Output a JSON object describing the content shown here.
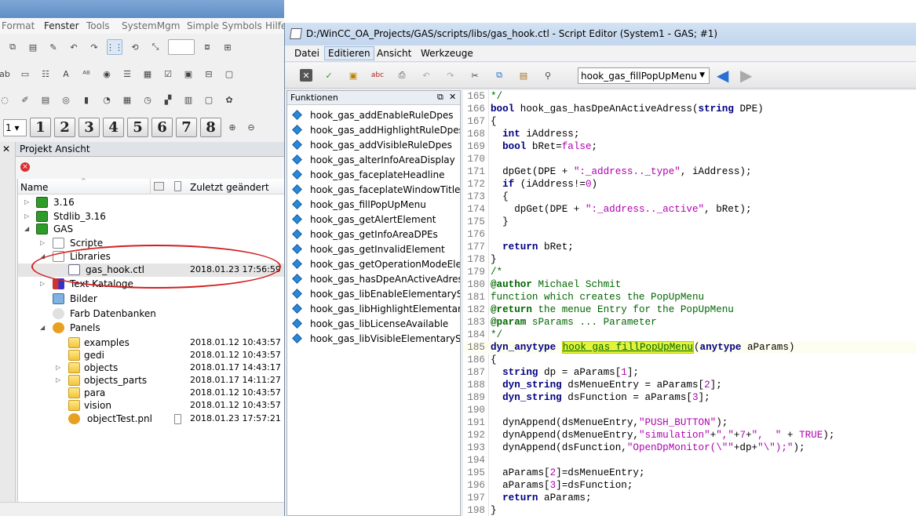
{
  "back_window": {
    "menu": [
      "Format",
      "Fenster",
      "Tools",
      "SystemMgm",
      "Simple Symbols",
      "Hilfe"
    ],
    "zoom_select": "1",
    "layer_buttons": [
      "2",
      "3",
      "4",
      "5",
      "6",
      "7",
      "8"
    ],
    "project_panel_title": "Projekt Ansicht",
    "tree_columns": {
      "name": "Name",
      "modified": "Zuletzt geändert"
    },
    "tree": [
      {
        "label": "3.16",
        "date": ""
      },
      {
        "label": "Stdlib_3.16",
        "date": ""
      },
      {
        "label": "GAS",
        "date": ""
      },
      {
        "label": "Scripte",
        "date": ""
      },
      {
        "label": "Libraries",
        "date": ""
      },
      {
        "label": "gas_hook.ctl",
        "date": "2018.01.23 17:56:59"
      },
      {
        "label": "Text Kataloge",
        "date": ""
      },
      {
        "label": "Bilder",
        "date": ""
      },
      {
        "label": "Farb Datenbanken",
        "date": ""
      },
      {
        "label": "Panels",
        "date": ""
      },
      {
        "label": "examples",
        "date": "2018.01.12 10:43:57"
      },
      {
        "label": "gedi",
        "date": "2018.01.12 10:43:57"
      },
      {
        "label": "objects",
        "date": "2018.01.17 14:43:17"
      },
      {
        "label": "objects_parts",
        "date": "2018.01.17 14:11:27"
      },
      {
        "label": "para",
        "date": "2018.01.12 10:43:57"
      },
      {
        "label": "vision",
        "date": "2018.01.12 10:43:57"
      },
      {
        "label": "objectTest.pnl",
        "date": "2018.01.23 17:57:21"
      }
    ]
  },
  "editor": {
    "title": "D:/WinCC_OA_Projects/GAS/scripts/libs/gas_hook.ctl - Script Editor (System1 - GAS; #1)",
    "menu": [
      "Datei",
      "Editieren",
      "Ansicht",
      "Werkzeuge"
    ],
    "function_select": "hook_gas_fillPopUpMenu",
    "functions_panel_title": "Funktionen",
    "functions": [
      "hook_gas_addEnableRuleDpes",
      "hook_gas_addHighlightRuleDpes",
      "hook_gas_addVisibleRuleDpes",
      "hook_gas_alterInfoAreaDisplay",
      "hook_gas_faceplateHeadline",
      "hook_gas_faceplateWindowTitle",
      "hook_gas_fillPopUpMenu",
      "hook_gas_getAlertElement",
      "hook_gas_getInfoAreaDPEs",
      "hook_gas_getInvalidElement",
      "hook_gas_getOperationModeElement",
      "hook_gas_hasDpeAnActiveAdress",
      "hook_gas_libEnableElementarySymbol",
      "hook_gas_libHighlightElementarySymbol",
      "hook_gas_libLicenseAvailable",
      "hook_gas_libVisibleElementarySymbol"
    ],
    "code": [
      {
        "n": "165",
        "segs": [
          [
            "c",
            "*/"
          ]
        ]
      },
      {
        "n": "166",
        "segs": [
          [
            "k",
            "bool"
          ],
          [
            "p",
            " hook_gas_hasDpeAnActiveAdress("
          ],
          [
            "k",
            "string"
          ],
          [
            "p",
            " DPE)"
          ]
        ]
      },
      {
        "n": "167",
        "segs": [
          [
            "p",
            "{"
          ]
        ]
      },
      {
        "n": "168",
        "segs": [
          [
            "p",
            "  "
          ],
          [
            "k",
            "int"
          ],
          [
            "p",
            " iAddress;"
          ]
        ]
      },
      {
        "n": "169",
        "segs": [
          [
            "p",
            "  "
          ],
          [
            "k",
            "bool"
          ],
          [
            "p",
            " bRet="
          ],
          [
            "s",
            "false"
          ],
          [
            "p",
            ";"
          ]
        ]
      },
      {
        "n": "170",
        "segs": [
          [
            "p",
            ""
          ]
        ]
      },
      {
        "n": "171",
        "segs": [
          [
            "p",
            "  dpGet(DPE + "
          ],
          [
            "s",
            "\":_address.._type\""
          ],
          [
            "p",
            ", iAddress);"
          ]
        ]
      },
      {
        "n": "172",
        "segs": [
          [
            "p",
            "  "
          ],
          [
            "k",
            "if"
          ],
          [
            "p",
            " (iAddress!="
          ],
          [
            "s",
            "0"
          ],
          [
            "p",
            ")"
          ]
        ]
      },
      {
        "n": "173",
        "segs": [
          [
            "p",
            "  {"
          ]
        ]
      },
      {
        "n": "174",
        "segs": [
          [
            "p",
            "    dpGet(DPE + "
          ],
          [
            "s",
            "\":_address.._active\""
          ],
          [
            "p",
            ", bRet);"
          ]
        ]
      },
      {
        "n": "175",
        "segs": [
          [
            "p",
            "  }"
          ]
        ]
      },
      {
        "n": "176",
        "segs": [
          [
            "p",
            ""
          ]
        ]
      },
      {
        "n": "177",
        "segs": [
          [
            "p",
            "  "
          ],
          [
            "k",
            "return"
          ],
          [
            "p",
            " bRet;"
          ]
        ]
      },
      {
        "n": "178",
        "segs": [
          [
            "p",
            "}"
          ]
        ]
      },
      {
        "n": "179",
        "segs": [
          [
            "c",
            "/*"
          ]
        ]
      },
      {
        "n": "180",
        "segs": [
          [
            "a",
            "@author"
          ],
          [
            "c",
            " Michael Schmit"
          ]
        ]
      },
      {
        "n": "181",
        "segs": [
          [
            "c",
            "function which creates the PopUpMenu"
          ]
        ]
      },
      {
        "n": "182",
        "segs": [
          [
            "a",
            "@return"
          ],
          [
            "c",
            " the menue Entry for the PopUpMenu"
          ]
        ]
      },
      {
        "n": "183",
        "segs": [
          [
            "a",
            "@param"
          ],
          [
            "c",
            " sParams ... Parameter"
          ]
        ]
      },
      {
        "n": "184",
        "segs": [
          [
            "c",
            "*/"
          ]
        ]
      },
      {
        "n": "185",
        "segs": [
          [
            "k",
            "dyn_anytype"
          ],
          [
            "p",
            " "
          ],
          [
            "h",
            "hook_gas_fillPopUpMenu"
          ],
          [
            "p",
            "("
          ],
          [
            "k",
            "anytype"
          ],
          [
            "p",
            " aParams)"
          ]
        ]
      },
      {
        "n": "186",
        "segs": [
          [
            "p",
            "{"
          ]
        ]
      },
      {
        "n": "187",
        "segs": [
          [
            "p",
            "  "
          ],
          [
            "k",
            "string"
          ],
          [
            "p",
            " dp = aParams["
          ],
          [
            "s",
            "1"
          ],
          [
            "p",
            "];"
          ]
        ]
      },
      {
        "n": "188",
        "segs": [
          [
            "p",
            "  "
          ],
          [
            "k",
            "dyn_string"
          ],
          [
            "p",
            " dsMenueEntry = aParams["
          ],
          [
            "s",
            "2"
          ],
          [
            "p",
            "];"
          ]
        ]
      },
      {
        "n": "189",
        "segs": [
          [
            "p",
            "  "
          ],
          [
            "k",
            "dyn_string"
          ],
          [
            "p",
            " dsFunction = aParams["
          ],
          [
            "s",
            "3"
          ],
          [
            "p",
            "];"
          ]
        ]
      },
      {
        "n": "190",
        "segs": [
          [
            "p",
            ""
          ]
        ]
      },
      {
        "n": "191",
        "segs": [
          [
            "p",
            "  dynAppend(dsMenueEntry,"
          ],
          [
            "s",
            "\"PUSH_BUTTON\""
          ],
          [
            "p",
            ");"
          ]
        ]
      },
      {
        "n": "192",
        "segs": [
          [
            "p",
            "  dynAppend(dsMenueEntry,"
          ],
          [
            "s",
            "\"simulation\""
          ],
          [
            "p",
            "+"
          ],
          [
            "s",
            "\",\""
          ],
          [
            "p",
            "+"
          ],
          [
            "s",
            "7"
          ],
          [
            "p",
            "+"
          ],
          [
            "s",
            "\",  \""
          ],
          [
            "p",
            " + "
          ],
          [
            "s",
            "TRUE"
          ],
          [
            "p",
            ");"
          ]
        ]
      },
      {
        "n": "193",
        "segs": [
          [
            "p",
            "  dynAppend(dsFunction,"
          ],
          [
            "s",
            "\"OpenDpMonitor(\\\"\""
          ],
          [
            "p",
            "+dp+"
          ],
          [
            "s",
            "\"\\\");\""
          ],
          [
            "p",
            ");"
          ]
        ]
      },
      {
        "n": "194",
        "segs": [
          [
            "p",
            ""
          ]
        ]
      },
      {
        "n": "195",
        "segs": [
          [
            "p",
            "  aParams["
          ],
          [
            "s",
            "2"
          ],
          [
            "p",
            "]=dsMenueEntry;"
          ]
        ]
      },
      {
        "n": "196",
        "segs": [
          [
            "p",
            "  aParams["
          ],
          [
            "s",
            "3"
          ],
          [
            "p",
            "]=dsFunction;"
          ]
        ]
      },
      {
        "n": "197",
        "segs": [
          [
            "p",
            "  "
          ],
          [
            "k",
            "return"
          ],
          [
            "p",
            " aParams;"
          ]
        ]
      },
      {
        "n": "198",
        "segs": [
          [
            "p",
            "}"
          ]
        ]
      }
    ]
  }
}
